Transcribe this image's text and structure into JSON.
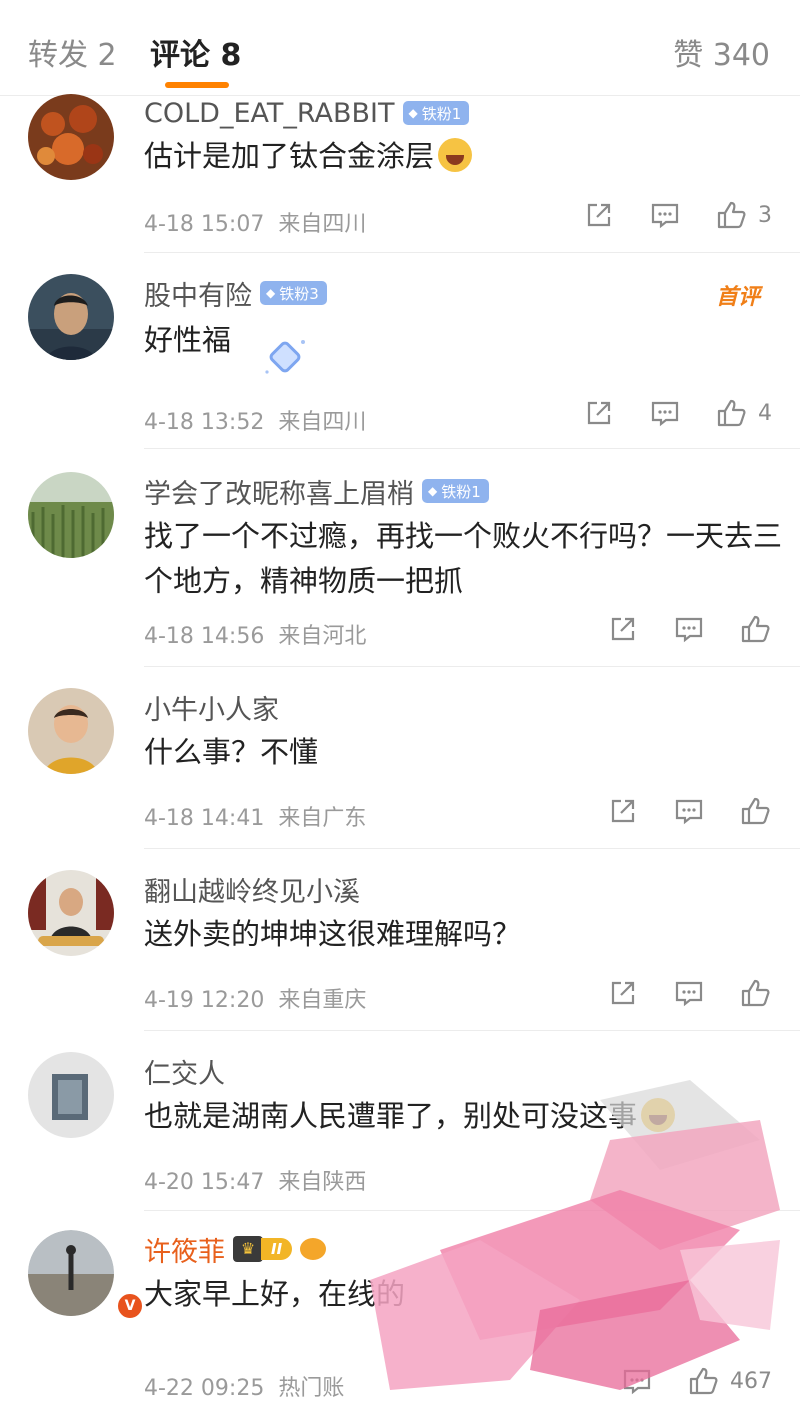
{
  "tabs": {
    "repost": "转发 2",
    "comments": "评论 8",
    "likes": "赞 340"
  },
  "comments": [
    {
      "username": "COLD_EAT_RABBIT",
      "badge": "铁粉1",
      "text": "估计是加了钛合金涂层",
      "time": "4-18 15:07",
      "location": "来自四川",
      "likes": "3"
    },
    {
      "username": "股中有险",
      "badge": "铁粉3",
      "tag": "首评",
      "text": "好性福",
      "time": "4-18 13:52",
      "location": "来自四川",
      "likes": "4"
    },
    {
      "username": "学会了改昵称喜上眉梢",
      "badge": "铁粉1",
      "text": "找了一个不过瘾，再找一个败火不行吗？一天去三个地方，精神物质一把抓",
      "time": "4-18 14:56",
      "location": "来自河北"
    },
    {
      "username": "小牛小人家",
      "text": "什么事？不懂",
      "time": "4-18 14:41",
      "location": "来自广东"
    },
    {
      "username": "翻山越岭终见小溪",
      "text": "送外卖的坤坤这很难理解吗？",
      "time": "4-19 12:20",
      "location": "来自重庆"
    },
    {
      "username": "仁交人",
      "text": "也就是湖南人民遭罪了，别处可没这事",
      "time": "4-20 15:47",
      "location": "来自陕西"
    },
    {
      "username": "许筱菲",
      "level": "II",
      "avatar_badge": "V",
      "text": "大家早上好，在线的",
      "time": "4-22 09:25",
      "location": "热门账",
      "likes": "467"
    }
  ],
  "icons": {
    "share": "share-icon",
    "comment": "comment-icon",
    "like": "thumbs-up-icon"
  },
  "colors": {
    "accent": "#ff8200",
    "fan_badge": "#8fb3ee",
    "first_tag": "#f07f18",
    "vip_name": "#e8601c"
  }
}
